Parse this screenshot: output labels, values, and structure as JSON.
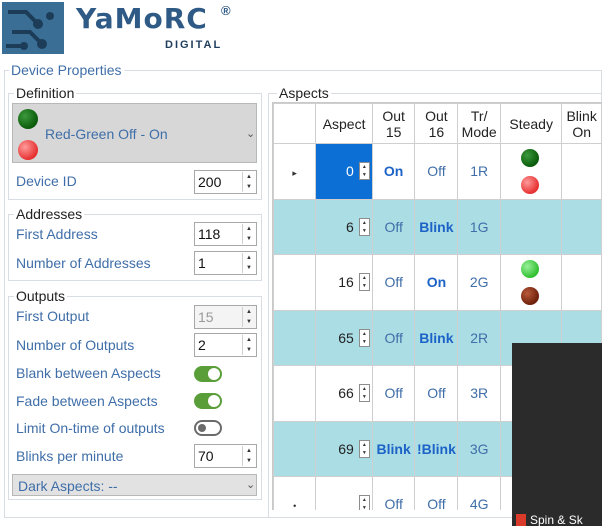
{
  "logo": {
    "text": "YaMoRC",
    "reg": "®",
    "sub": "DIGITAL"
  },
  "device_properties": {
    "legend": "Device Properties",
    "definition": {
      "legend": "Definition",
      "combo_value": "Red-Green Off - On",
      "leds": [
        "dark-green",
        "red"
      ]
    },
    "device_id": {
      "label": "Device ID",
      "value": "200"
    },
    "addresses": {
      "legend": "Addresses",
      "first_address": {
        "label": "First Address",
        "value": "118"
      },
      "number_of_addresses": {
        "label": "Number of Addresses",
        "value": "1"
      }
    },
    "outputs": {
      "legend": "Outputs",
      "first_output": {
        "label": "First Output",
        "value": "15"
      },
      "number_of_outputs": {
        "label": "Number of Outputs",
        "value": "2"
      },
      "blank_between_aspects": {
        "label": "Blank between Aspects",
        "on": true
      },
      "fade_between_aspects": {
        "label": "Fade between Aspects",
        "on": true
      },
      "limit_on_time": {
        "label": "Limit On-time of outputs",
        "on": false
      },
      "blinks_per_minute": {
        "label": "Blinks per minute",
        "value": "70"
      }
    },
    "dark_aspects": "Dark Aspects: --"
  },
  "aspects": {
    "legend": "Aspects",
    "columns": [
      "",
      "Aspect",
      "Out\n15",
      "Out\n16",
      "Tr/\nMode",
      "Steady",
      "Blink\nOn"
    ],
    "rows": [
      {
        "marker": "▸",
        "aspect": "0",
        "out15": "On",
        "out16": "Off",
        "mode": "1R",
        "steady": [
          "dark-green",
          "red"
        ],
        "selected": true,
        "teal": false
      },
      {
        "marker": "",
        "aspect": "6",
        "out15": "Off",
        "out16": "Blink",
        "mode": "1G",
        "steady": [],
        "selected": false,
        "teal": true
      },
      {
        "marker": "",
        "aspect": "16",
        "out15": "Off",
        "out16": "On",
        "mode": "2G",
        "steady": [
          "light-green",
          "brown"
        ],
        "selected": false,
        "teal": false
      },
      {
        "marker": "",
        "aspect": "65",
        "out15": "Off",
        "out16": "Blink",
        "mode": "2R",
        "steady": [],
        "selected": false,
        "teal": true
      },
      {
        "marker": "",
        "aspect": "66",
        "out15": "Off",
        "out16": "Off",
        "mode": "3R",
        "steady": [],
        "selected": false,
        "teal": false
      },
      {
        "marker": "",
        "aspect": "69",
        "out15": "Blink",
        "out16": "!Blink",
        "mode": "3G",
        "steady": [],
        "selected": false,
        "teal": true
      },
      {
        "marker": "•",
        "aspect": "",
        "out15": "Off",
        "out16": "Off",
        "mode": "4G",
        "steady": [],
        "selected": false,
        "teal": false
      }
    ]
  },
  "popup": {
    "text": "Spin & Sk"
  }
}
